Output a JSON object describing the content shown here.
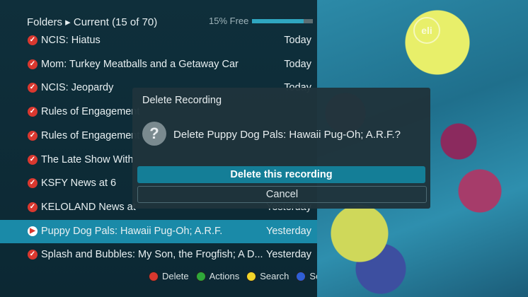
{
  "header": {
    "breadcrumb": "Folders ▸ Current (15 of 70)",
    "free_label": "15% Free",
    "free_fraction": 0.85
  },
  "brand": {
    "logo_text": "eli"
  },
  "recordings": [
    {
      "title": "NCIS: Hiatus",
      "date": "Today",
      "icon": "check-icon"
    },
    {
      "title": "Mom: Turkey Meatballs and a Getaway Car",
      "date": "Today",
      "icon": "check-icon"
    },
    {
      "title": "NCIS: Jeopardy",
      "date": "Today",
      "icon": "check-icon"
    },
    {
      "title": "Rules of Engagement",
      "date": "",
      "icon": "check-icon"
    },
    {
      "title": "Rules of Engagement",
      "date": "",
      "icon": "check-icon"
    },
    {
      "title": "The Late Show With",
      "date": "",
      "icon": "check-icon"
    },
    {
      "title": "KSFY News at 6",
      "date": "",
      "icon": "check-icon"
    },
    {
      "title": "KELOLAND News at",
      "date": "Yesterday",
      "icon": "check-icon"
    },
    {
      "title": "Puppy Dog Pals: Hawaii Pug-Oh; A.R.F.",
      "date": "Yesterday",
      "icon": "play-icon",
      "selected": true
    },
    {
      "title": "Splash and Bubbles: My Son, the Frogfish; A D...",
      "date": "Yesterday",
      "icon": "check-icon"
    }
  ],
  "legend": [
    {
      "label": "Delete",
      "color": "#d9382f"
    },
    {
      "label": "Actions",
      "color": "#2fa83a"
    },
    {
      "label": "Search",
      "color": "#f2d52a"
    },
    {
      "label": "Sort",
      "color": "#2f5fd6"
    }
  ],
  "dialog": {
    "title": "Delete Recording",
    "question_icon": "?",
    "message": "Delete Puppy Dog Pals: Hawaii Pug-Oh; A.R.F.?",
    "primary_label": "Delete this recording",
    "secondary_label": "Cancel"
  }
}
